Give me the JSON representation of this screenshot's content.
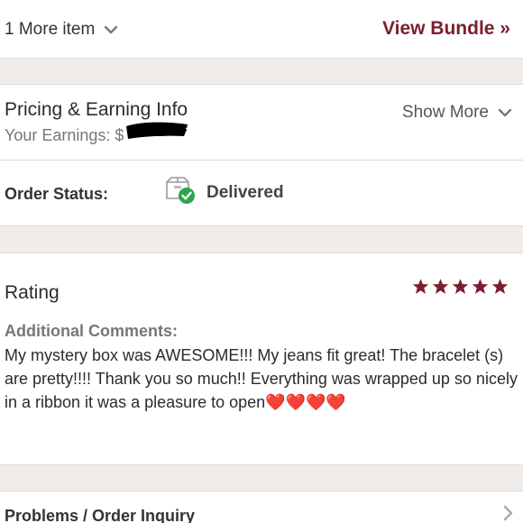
{
  "bundle": {
    "more_items_label": "1 More item",
    "view_bundle_label": "View Bundle »"
  },
  "pricing": {
    "title": "Pricing & Earning Info",
    "earnings_label": "Your Earnings: $",
    "show_more_label": "Show More"
  },
  "order_status": {
    "label": "Order Status:",
    "value": "Delivered",
    "icon": "package-delivered-icon"
  },
  "rating": {
    "title": "Rating",
    "stars": 5,
    "max_stars": 5,
    "comments_label": "Additional Comments:",
    "comment": "My mystery box was AWESOME!!! My jeans fit great! The bracelet (s) are pretty!!!! Thank you so much!! Everything was wrapped up so nicely in a ribbon it was a pleasure to open",
    "hearts": "❤️❤️❤️❤️"
  },
  "problems": {
    "label": "Problems / Order Inquiry"
  },
  "colors": {
    "accent": "#7a1f2e",
    "divider": "#efece9",
    "check": "#2ea44f",
    "heart": "#e02020"
  }
}
